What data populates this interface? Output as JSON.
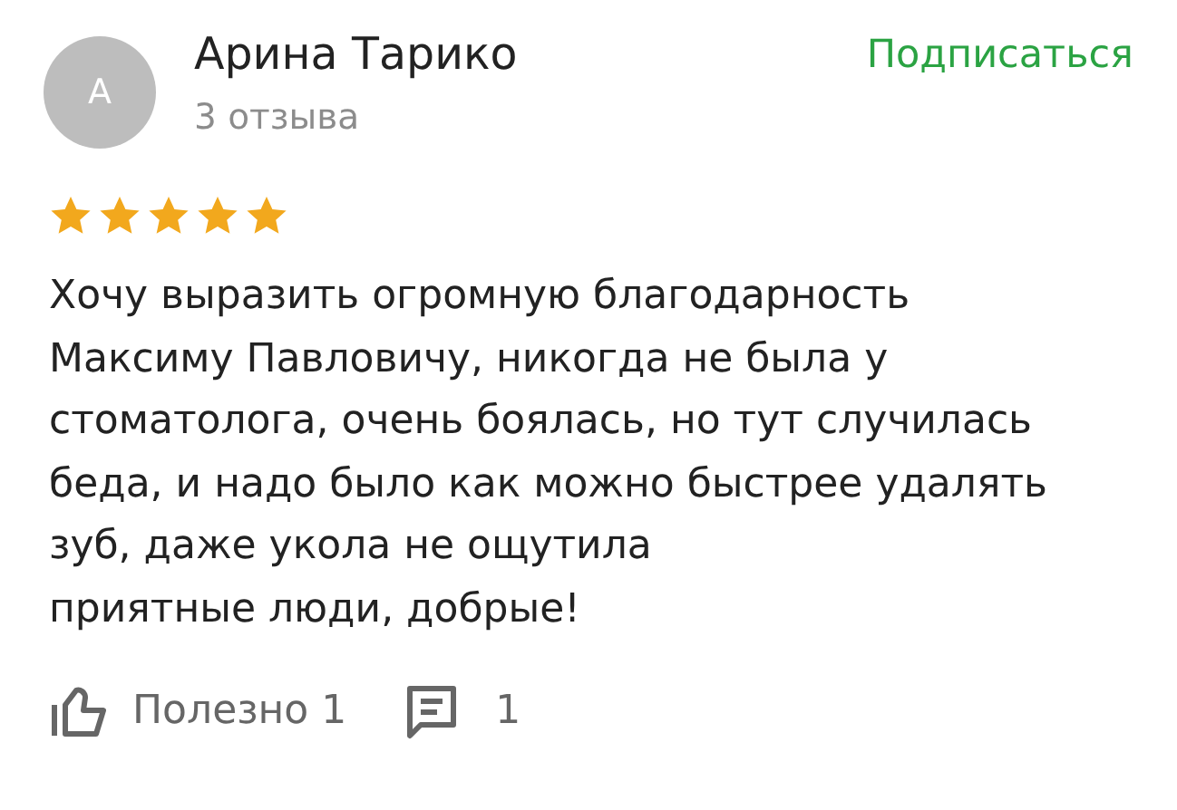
{
  "author": {
    "avatar_letter": "А",
    "name": "Арина Тарико",
    "reviews_count": "3 отзыва"
  },
  "subscribe_button": "Подписаться",
  "rating": {
    "stars": 5
  },
  "review_lines": [
    "Хочу выразить огромную благодарность",
    "Максиму Павловичу, никогда не была у",
    "стоматолога, очень боялась, но тут случилась",
    "беда, и надо было как можно быстрее удалять",
    "зуб, даже укола не ощутила",
    "приятные люди, добрые!"
  ],
  "footer": {
    "useful_label": "Полезно",
    "useful_count": "1",
    "comments_count": "1"
  }
}
